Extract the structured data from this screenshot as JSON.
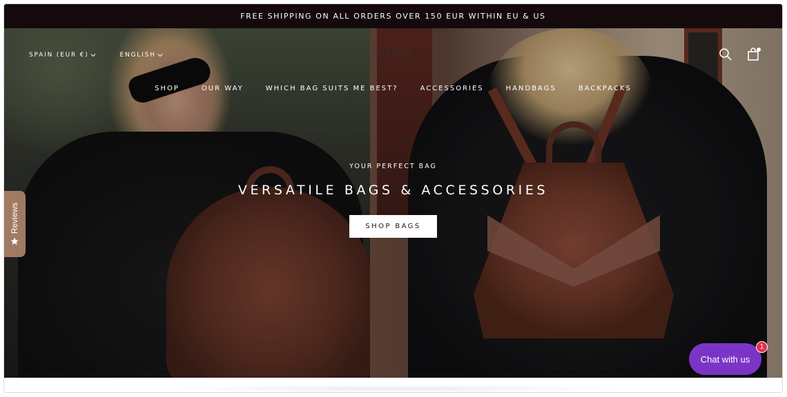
{
  "announcement": {
    "text": "FREE SHIPPING ON ALL ORDERS OVER 150 EUR WITHIN EU & US"
  },
  "header": {
    "country_selector": "SPAIN (EUR €)",
    "language_selector": "ENGLISH",
    "logo": "BUKY",
    "icons": [
      "search-icon",
      "cart-icon"
    ]
  },
  "nav": {
    "items": [
      "SHOP",
      "OUR WAY",
      "WHICH BAG SUITS ME BEST?",
      "ACCESSORIES",
      "HANDBAGS",
      "BACKPACKS"
    ]
  },
  "hero": {
    "subtitle": "YOUR PERFECT BAG",
    "title": "VERSATILE BAGS & ACCESSORIES",
    "cta": "SHOP BAGS"
  },
  "reviews_tab": {
    "label": "Reviews",
    "icon": "star-icon"
  },
  "chat": {
    "label": "Chat with us",
    "badge": "1"
  },
  "colors": {
    "announcement_bg": "#140a0c",
    "reviews_tab_bg": "#a17a62",
    "chat_bg": "#7b35c6",
    "chat_badge_bg": "#e4304a"
  }
}
